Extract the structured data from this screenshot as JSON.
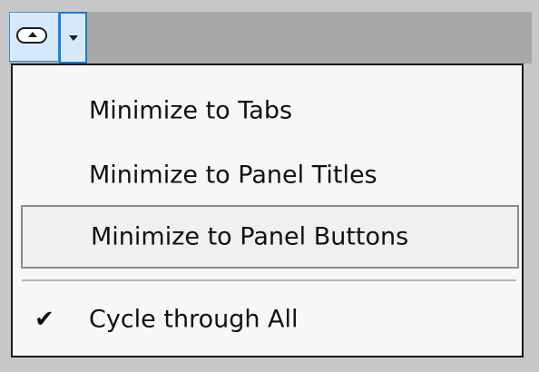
{
  "toolbar": {
    "minimize_button_icon": "minimize-ribbon-icon",
    "dropdown_icon": "chevron-down-icon"
  },
  "menu": {
    "items": [
      {
        "label": "Minimize to Tabs",
        "checked": false,
        "highlighted": false
      },
      {
        "label": "Minimize to Panel Titles",
        "checked": false,
        "highlighted": false
      },
      {
        "label": "Minimize to Panel Buttons",
        "checked": false,
        "highlighted": true
      },
      {
        "label": "Cycle through All",
        "checked": true,
        "highlighted": false
      }
    ],
    "check_glyph": "✔"
  },
  "colors": {
    "background": "#c8c8c8",
    "toolbar": "#a8a8a8",
    "button_highlight": "#d6e9fb",
    "button_border": "#1a78d4",
    "menu_background": "#f7f7f7",
    "menu_border": "#1a1a1a"
  }
}
